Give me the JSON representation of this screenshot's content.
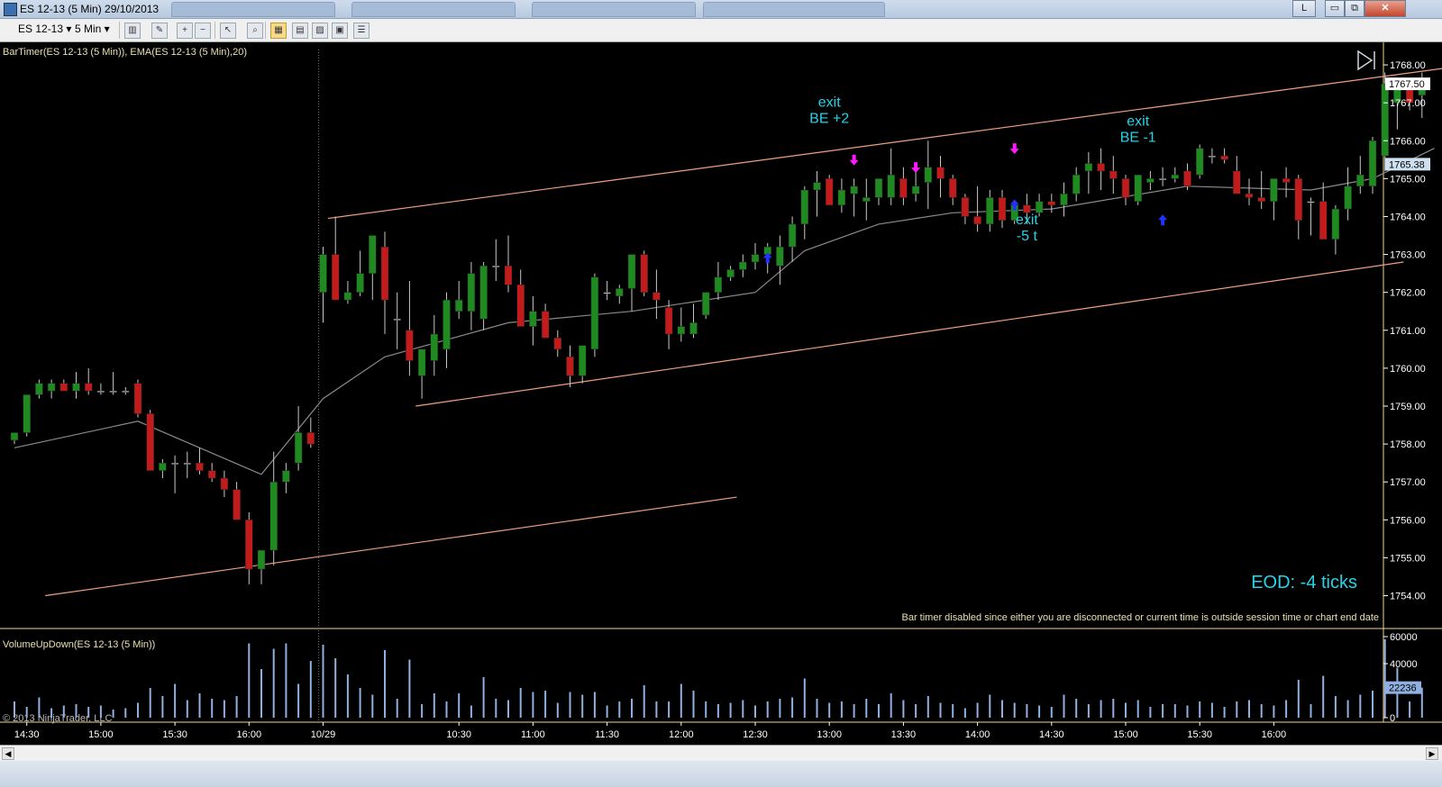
{
  "window": {
    "title": "ES 12-13 (5 Min)  29/10/2013",
    "btn_l": "L",
    "btn_min": "▭",
    "btn_max": "⧉",
    "btn_close": "✕"
  },
  "toolbar": {
    "instrument": "ES 12-13",
    "interval": "5 Min"
  },
  "colors": {
    "up": "#1f8a1f",
    "down": "#c11b1b",
    "wick": "#c8c8c8",
    "channel": "#f0a080",
    "ema": "#8a8a8a",
    "volume": "#8fb0e0",
    "annotation": "#27d3e8",
    "arrow_sell": "#ff1aff",
    "arrow_buy": "#2233ff",
    "axis_text": "#ffffff",
    "label_text": "#e8e0b0"
  },
  "price_panel": {
    "indicator_label": "BarTimer(ES 12-13 (5 Min)), EMA(ES 12-13 (5 Min),20)",
    "ylim": [
      1753.3,
      1768.5
    ],
    "y_ticks": [
      "1768.00",
      "1767.00",
      "1766.00",
      "1765.00",
      "1764.00",
      "1763.00",
      "1762.00",
      "1761.00",
      "1760.00",
      "1759.00",
      "1758.00",
      "1757.00",
      "1756.00",
      "1755.00",
      "1754.00"
    ],
    "last_price": "1767.50",
    "ema_value": "1765.38",
    "bartimer_message": "Bar timer disabled since either you are disconnected or current time is outside session time or chart end date",
    "eod_text": "EOD: -4 ticks",
    "annotations": [
      {
        "lines": [
          "exit",
          "BE +2"
        ],
        "x": "13:00",
        "y": 1766.9
      },
      {
        "lines": [
          "exit",
          "-5 t"
        ],
        "x": "14:20",
        "y": 1763.8
      },
      {
        "lines": [
          "exit",
          "BE -1"
        ],
        "x": "15:05",
        "y": 1766.4
      }
    ]
  },
  "volume_panel": {
    "label": "VolumeUpDown(ES 12-13 (5 Min))",
    "ylim": [
      0,
      62000
    ],
    "y_ticks": [
      "60000",
      "40000",
      "0"
    ],
    "last_volume": "22236"
  },
  "copyright": "© 2013 NinjaTrader, LLC",
  "x_axis": {
    "labels": [
      "14:30",
      "15:00",
      "15:30",
      "16:00",
      "10/29",
      "10:30",
      "11:00",
      "11:30",
      "12:00",
      "12:30",
      "13:00",
      "13:30",
      "14:00",
      "14:30",
      "15:00",
      "15:30",
      "16:00"
    ],
    "session_break_after": "16:15"
  },
  "chart_data": {
    "type": "candlestick",
    "columns": [
      "open",
      "high",
      "low",
      "close",
      "volume"
    ],
    "bars": [
      [
        1758.1,
        1758.3,
        1758.0,
        1758.3,
        12000
      ],
      [
        1758.3,
        1759.3,
        1758.2,
        1759.3,
        8000
      ],
      [
        1759.3,
        1759.7,
        1759.2,
        1759.6,
        15000
      ],
      [
        1759.4,
        1759.7,
        1759.2,
        1759.6,
        7000
      ],
      [
        1759.6,
        1759.7,
        1759.4,
        1759.4,
        9000
      ],
      [
        1759.4,
        1759.9,
        1759.2,
        1759.6,
        10000
      ],
      [
        1759.6,
        1760.0,
        1759.3,
        1759.4,
        8000
      ],
      [
        1759.4,
        1759.6,
        1759.3,
        1759.4,
        9000
      ],
      [
        1759.4,
        1759.9,
        1759.3,
        1759.4,
        6000
      ],
      [
        1759.4,
        1759.5,
        1759.3,
        1759.4,
        7000
      ],
      [
        1759.6,
        1759.7,
        1758.7,
        1758.8,
        11000
      ],
      [
        1758.8,
        1758.9,
        1757.3,
        1757.3,
        22000
      ],
      [
        1757.3,
        1757.6,
        1757.1,
        1757.5,
        16000
      ],
      [
        1757.5,
        1757.7,
        1756.7,
        1757.5,
        25000
      ],
      [
        1757.5,
        1757.8,
        1757.1,
        1757.5,
        13000
      ],
      [
        1757.5,
        1757.9,
        1757.2,
        1757.3,
        18000
      ],
      [
        1757.3,
        1757.5,
        1757.0,
        1757.1,
        14000
      ],
      [
        1757.1,
        1757.3,
        1756.6,
        1756.8,
        13000
      ],
      [
        1756.8,
        1757.0,
        1756.3,
        1756.0,
        16000
      ],
      [
        1756.0,
        1756.2,
        1754.3,
        1754.7,
        55000
      ],
      [
        1754.7,
        1755.2,
        1754.3,
        1755.2,
        36000
      ],
      [
        1755.2,
        1757.8,
        1754.8,
        1757.0,
        51000
      ],
      [
        1757.0,
        1757.5,
        1756.7,
        1757.3,
        55000
      ],
      [
        1757.5,
        1759.0,
        1757.3,
        1758.3,
        25000
      ],
      [
        1758.3,
        1758.7,
        1757.9,
        1758.0,
        42000
      ],
      [
        1762.0,
        1763.2,
        1761.2,
        1763.0,
        54000
      ],
      [
        1763.0,
        1764.0,
        1761.8,
        1761.8,
        44000
      ],
      [
        1761.8,
        1762.3,
        1761.7,
        1762.0,
        32000
      ],
      [
        1762.0,
        1763.1,
        1761.9,
        1762.5,
        22000
      ],
      [
        1762.5,
        1763.5,
        1761.8,
        1763.5,
        17000
      ],
      [
        1763.2,
        1763.6,
        1760.9,
        1761.8,
        50000
      ],
      [
        1761.3,
        1762.0,
        1760.5,
        1761.3,
        14000
      ],
      [
        1761.0,
        1762.3,
        1759.8,
        1760.2,
        43000
      ],
      [
        1759.8,
        1760.5,
        1759.2,
        1760.5,
        10000
      ],
      [
        1760.2,
        1761.4,
        1759.8,
        1760.9,
        18000
      ],
      [
        1760.5,
        1762.0,
        1760.0,
        1761.8,
        12000
      ],
      [
        1761.5,
        1762.3,
        1761.3,
        1761.8,
        18000
      ],
      [
        1761.5,
        1762.8,
        1761.0,
        1762.5,
        9000
      ],
      [
        1761.3,
        1762.8,
        1761.0,
        1762.7,
        30000
      ],
      [
        1762.7,
        1763.4,
        1762.3,
        1762.7,
        14000
      ],
      [
        1762.7,
        1763.5,
        1762.0,
        1762.2,
        13000
      ],
      [
        1762.2,
        1762.6,
        1761.1,
        1761.1,
        22000
      ],
      [
        1761.1,
        1761.9,
        1760.6,
        1761.5,
        19000
      ],
      [
        1761.5,
        1761.7,
        1760.9,
        1760.8,
        20000
      ],
      [
        1760.8,
        1761.0,
        1760.3,
        1760.5,
        11000
      ],
      [
        1760.3,
        1760.6,
        1759.5,
        1759.8,
        19000
      ],
      [
        1759.8,
        1760.4,
        1759.6,
        1760.6,
        17000
      ],
      [
        1760.5,
        1762.5,
        1760.3,
        1762.4,
        19000
      ],
      [
        1762.0,
        1762.3,
        1761.8,
        1762.0,
        9000
      ],
      [
        1761.9,
        1762.2,
        1761.7,
        1762.1,
        12000
      ],
      [
        1762.1,
        1763.0,
        1761.5,
        1763.0,
        14000
      ],
      [
        1763.0,
        1763.1,
        1761.9,
        1762.0,
        24000
      ],
      [
        1762.0,
        1762.6,
        1761.3,
        1761.8,
        12000
      ],
      [
        1761.6,
        1761.8,
        1760.5,
        1760.9,
        12000
      ],
      [
        1760.9,
        1761.6,
        1760.7,
        1761.1,
        25000
      ],
      [
        1760.9,
        1761.7,
        1760.8,
        1761.2,
        20000
      ],
      [
        1761.4,
        1762.0,
        1761.3,
        1762.0,
        12000
      ],
      [
        1762.0,
        1762.8,
        1761.8,
        1762.4,
        10000
      ],
      [
        1762.4,
        1762.7,
        1762.3,
        1762.6,
        11000
      ],
      [
        1762.6,
        1763.0,
        1762.4,
        1762.8,
        13000
      ],
      [
        1762.8,
        1763.3,
        1762.6,
        1763.0,
        9000
      ],
      [
        1763.0,
        1763.3,
        1762.5,
        1763.2,
        12000
      ],
      [
        1762.7,
        1763.5,
        1762.2,
        1763.2,
        14000
      ],
      [
        1763.2,
        1764.0,
        1762.8,
        1763.8,
        15000
      ],
      [
        1763.8,
        1764.8,
        1763.4,
        1764.7,
        29000
      ],
      [
        1764.7,
        1765.2,
        1764.0,
        1764.9,
        14000
      ],
      [
        1765.0,
        1765.1,
        1764.3,
        1764.3,
        11000
      ],
      [
        1764.3,
        1765.0,
        1764.1,
        1764.7,
        12000
      ],
      [
        1764.6,
        1765.0,
        1764.0,
        1764.8,
        10000
      ],
      [
        1764.4,
        1765.0,
        1763.9,
        1764.5,
        14000
      ],
      [
        1764.5,
        1765.0,
        1764.3,
        1765.0,
        10000
      ],
      [
        1764.5,
        1765.8,
        1764.3,
        1765.1,
        18000
      ],
      [
        1765.0,
        1765.3,
        1764.3,
        1764.5,
        13000
      ],
      [
        1764.6,
        1765.3,
        1764.4,
        1764.8,
        10000
      ],
      [
        1764.9,
        1766.0,
        1764.2,
        1765.3,
        16000
      ],
      [
        1765.3,
        1765.6,
        1764.5,
        1765.0,
        11000
      ],
      [
        1765.0,
        1765.1,
        1764.3,
        1764.5,
        10000
      ],
      [
        1764.5,
        1764.6,
        1763.8,
        1764.0,
        7000
      ],
      [
        1764.0,
        1764.8,
        1763.6,
        1763.8,
        11000
      ],
      [
        1763.8,
        1764.7,
        1763.6,
        1764.5,
        17000
      ],
      [
        1764.5,
        1764.7,
        1763.7,
        1763.9,
        13000
      ],
      [
        1763.9,
        1764.4,
        1763.8,
        1764.3,
        11000
      ],
      [
        1764.3,
        1764.6,
        1763.8,
        1764.1,
        10000
      ],
      [
        1764.1,
        1764.6,
        1764.0,
        1764.4,
        9000
      ],
      [
        1764.4,
        1764.6,
        1764.1,
        1764.3,
        8000
      ],
      [
        1764.3,
        1764.9,
        1764.0,
        1764.6,
        17000
      ],
      [
        1764.6,
        1765.3,
        1764.4,
        1765.1,
        14000
      ],
      [
        1765.2,
        1765.7,
        1764.6,
        1765.4,
        10000
      ],
      [
        1765.4,
        1765.8,
        1764.7,
        1765.2,
        13000
      ],
      [
        1765.2,
        1765.6,
        1764.6,
        1765.0,
        14000
      ],
      [
        1765.0,
        1765.1,
        1764.3,
        1764.5,
        11000
      ],
      [
        1764.4,
        1765.1,
        1764.3,
        1765.1,
        13000
      ],
      [
        1764.9,
        1765.2,
        1764.7,
        1765.0,
        8000
      ],
      [
        1765.0,
        1765.3,
        1764.8,
        1765.0,
        10000
      ],
      [
        1765.0,
        1765.3,
        1764.9,
        1765.1,
        10000
      ],
      [
        1765.2,
        1765.4,
        1764.7,
        1764.8,
        9000
      ],
      [
        1765.1,
        1765.9,
        1765.0,
        1765.8,
        12000
      ],
      [
        1765.6,
        1765.8,
        1765.4,
        1765.6,
        11000
      ],
      [
        1765.6,
        1765.8,
        1765.4,
        1765.5,
        8000
      ],
      [
        1765.2,
        1765.6,
        1764.9,
        1764.6,
        12000
      ],
      [
        1764.6,
        1765.0,
        1764.3,
        1764.5,
        13000
      ],
      [
        1764.5,
        1765.2,
        1764.2,
        1764.4,
        10000
      ],
      [
        1764.4,
        1765.0,
        1763.9,
        1765.0,
        9000
      ],
      [
        1765.0,
        1765.3,
        1764.5,
        1764.9,
        13000
      ],
      [
        1765.0,
        1765.1,
        1763.4,
        1763.9,
        28000
      ],
      [
        1764.4,
        1764.5,
        1763.5,
        1764.4,
        10000
      ],
      [
        1764.4,
        1764.9,
        1763.8,
        1763.4,
        31000
      ],
      [
        1763.4,
        1764.3,
        1763.0,
        1764.2,
        16000
      ],
      [
        1764.2,
        1765.3,
        1763.9,
        1764.8,
        13000
      ],
      [
        1764.8,
        1765.6,
        1764.6,
        1765.1,
        17000
      ],
      [
        1764.8,
        1766.1,
        1764.6,
        1766.0,
        20000
      ],
      [
        1765.6,
        1767.8,
        1765.2,
        1767.5,
        58000
      ],
      [
        1767.0,
        1767.6,
        1766.3,
        1767.5,
        37000
      ],
      [
        1767.5,
        1767.6,
        1766.8,
        1767.0,
        12000
      ],
      [
        1767.2,
        1767.8,
        1766.6,
        1767.5,
        22236
      ]
    ],
    "session_break_index": 25,
    "ema": [
      [
        0,
        1757.9
      ],
      [
        10,
        1758.6
      ],
      [
        20,
        1757.2
      ],
      [
        25,
        1759.2
      ],
      [
        30,
        1760.3
      ],
      [
        40,
        1761.2
      ],
      [
        50,
        1761.5
      ],
      [
        60,
        1762.0
      ],
      [
        64,
        1763.1
      ],
      [
        70,
        1763.8
      ],
      [
        76,
        1764.1
      ],
      [
        84,
        1764.2
      ],
      [
        95,
        1764.8
      ],
      [
        105,
        1764.7
      ],
      [
        110,
        1765.0
      ],
      [
        115,
        1765.8
      ]
    ],
    "channels": [
      {
        "i1": 25.4,
        "p1": 1763.95,
        "i2": 116.7,
        "p2": 1767.95
      },
      {
        "i1": 32.5,
        "p1": 1759.0,
        "i2": 112.5,
        "p2": 1762.8
      },
      {
        "i1": 2.5,
        "p1": 1754.0,
        "i2": 58.5,
        "p2": 1756.6
      }
    ],
    "sell_arrows": [
      [
        68,
        1765.3
      ],
      [
        73,
        1765.1
      ],
      [
        81,
        1765.6
      ]
    ],
    "buy_arrows": [
      [
        61,
        1763.1
      ],
      [
        81,
        1764.5
      ],
      [
        93,
        1764.1
      ]
    ]
  }
}
